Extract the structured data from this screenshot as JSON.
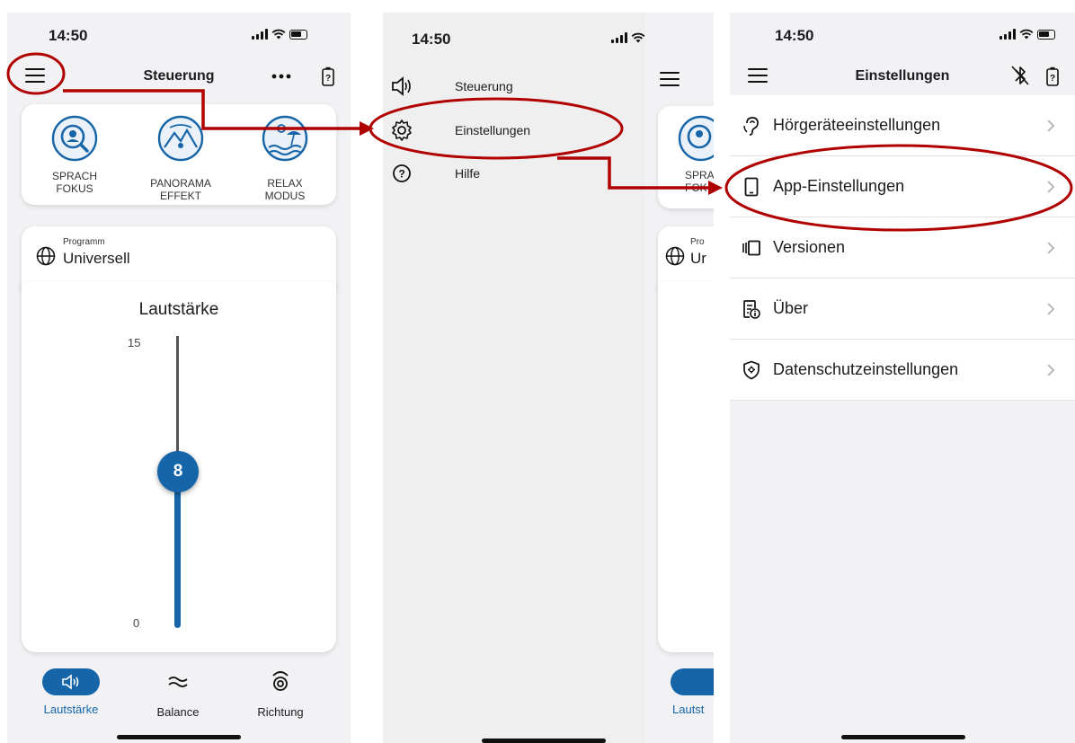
{
  "colors": {
    "accent": "#1565a8",
    "annotation": "#b00000",
    "text": "#1c1c1e"
  },
  "screen1": {
    "status_time": "14:50",
    "title": "Steuerung",
    "more_icon": "ellipsis-icon",
    "modes": [
      {
        "line1": "SPRACH",
        "line2": "FOKUS"
      },
      {
        "line1": "PANORAMA",
        "line2": "EFFEKT"
      },
      {
        "line1": "RELAX",
        "line2": "MODUS"
      }
    ],
    "program_label": "Programm",
    "program_value": "Universell",
    "volume_title": "Lautstärke",
    "volume_max": "15",
    "volume_min": "0",
    "volume_value": "8",
    "tabs": [
      "Lautstärke",
      "Balance",
      "Richtung"
    ]
  },
  "screen2": {
    "status_time": "14:50",
    "menu": [
      "Steuerung",
      "Einstellungen",
      "Hilfe"
    ],
    "peek_mode_line1": "SPRA",
    "peek_mode_line2": "FOK",
    "peek_program_label": "Pro",
    "peek_program_value": "Ur",
    "peek_tab": "Lautst"
  },
  "screen3": {
    "status_time": "14:50",
    "title": "Einstellungen",
    "items": [
      "Hörgeräteeinstellungen",
      "App-Einstellungen",
      "Versionen",
      "Über",
      "Datenschutzeinstellungen"
    ]
  }
}
